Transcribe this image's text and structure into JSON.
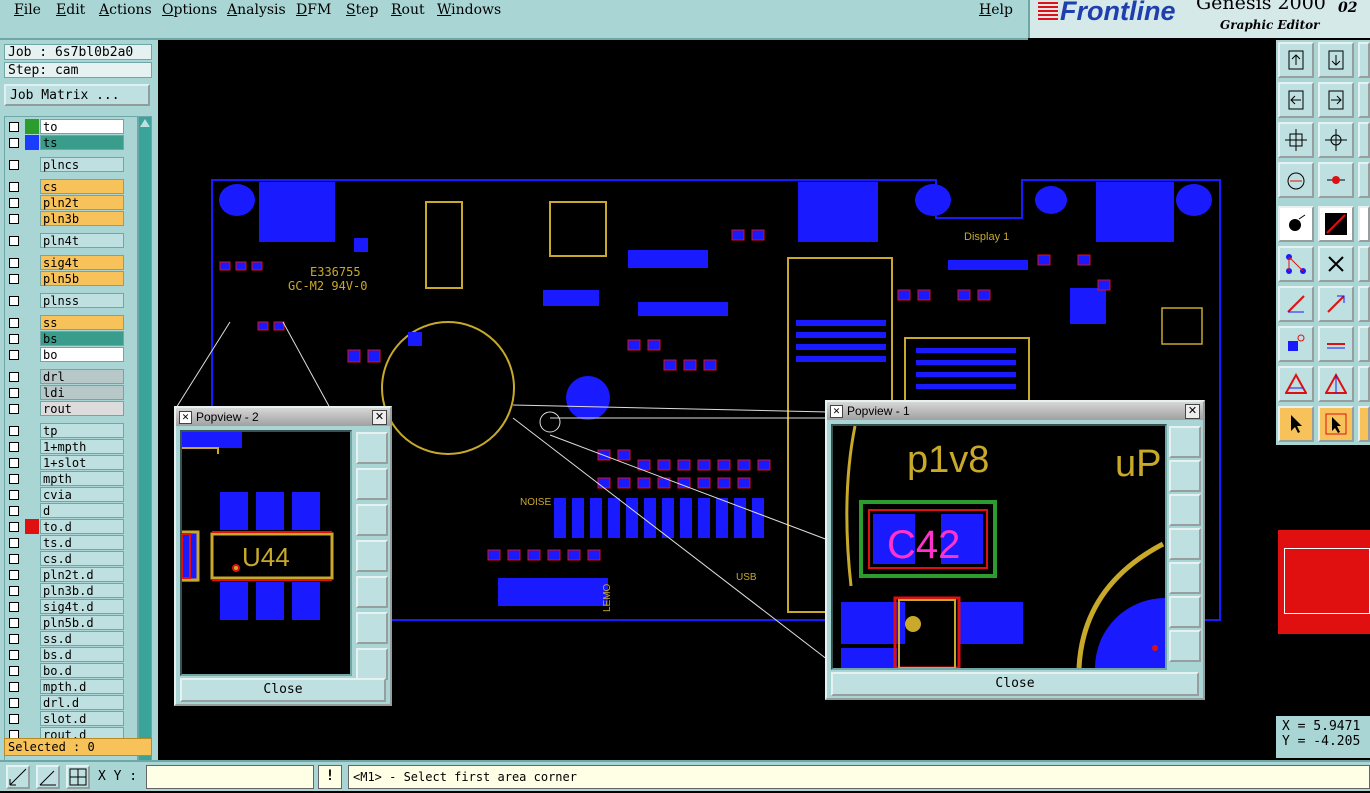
{
  "menubar": {
    "items": [
      "File",
      "Edit",
      "Actions",
      "Options",
      "Analysis",
      "DFM",
      "Step",
      "Rout",
      "Windows"
    ],
    "help": "Help"
  },
  "brand": {
    "logo": "Frontline",
    "product": "Genesis 2000",
    "version": "02",
    "subtitle": "Graphic Editor"
  },
  "left_panel": {
    "job": "Job : 6s7bl0b2a0",
    "step": "Step: cam",
    "job_matrix_button": "Job Matrix ...",
    "selected": "Selected : 0",
    "layers": [
      {
        "name": "to",
        "color": "#ffffff",
        "marker": "#2c9c2c"
      },
      {
        "name": "ts",
        "color": "#3a9c8a",
        "marker": "#1a3cff"
      },
      {
        "name": "plncs",
        "color": "#bfe0e0",
        "marker": ""
      },
      {
        "name": "cs",
        "color": "#f7c25a",
        "marker": ""
      },
      {
        "name": "pln2t",
        "color": "#f7c25a",
        "marker": ""
      },
      {
        "name": "pln3b",
        "color": "#f7c25a",
        "marker": ""
      },
      {
        "name": "pln4t",
        "color": "#bfe0e0",
        "marker": ""
      },
      {
        "name": "sig4t",
        "color": "#f7c25a",
        "marker": ""
      },
      {
        "name": "pln5b",
        "color": "#f7c25a",
        "marker": ""
      },
      {
        "name": "plnss",
        "color": "#bfe0e0",
        "marker": ""
      },
      {
        "name": "ss",
        "color": "#f7c25a",
        "marker": ""
      },
      {
        "name": "bs",
        "color": "#3a9c8a",
        "marker": ""
      },
      {
        "name": "bo",
        "color": "#ffffff",
        "marker": ""
      },
      {
        "name": "drl",
        "color": "#b8c8c8",
        "marker": ""
      },
      {
        "name": "ldi",
        "color": "#b8c8c8",
        "marker": ""
      },
      {
        "name": "rout",
        "color": "#dcdcdc",
        "marker": ""
      },
      {
        "name": "tp",
        "color": "#bfe0e0",
        "marker": ""
      },
      {
        "name": "1+mpth",
        "color": "#bfe0e0",
        "marker": ""
      },
      {
        "name": "1+slot",
        "color": "#bfe0e0",
        "marker": ""
      },
      {
        "name": "mpth",
        "color": "#bfe0e0",
        "marker": ""
      },
      {
        "name": "cvia",
        "color": "#bfe0e0",
        "marker": ""
      },
      {
        "name": "d",
        "color": "#bfe0e0",
        "marker": ""
      },
      {
        "name": "to.d",
        "color": "#bfe0e0",
        "marker": "#e01010"
      },
      {
        "name": "ts.d",
        "color": "#bfe0e0",
        "marker": ""
      },
      {
        "name": "cs.d",
        "color": "#bfe0e0",
        "marker": ""
      },
      {
        "name": "pln2t.d",
        "color": "#bfe0e0",
        "marker": ""
      },
      {
        "name": "pln3b.d",
        "color": "#bfe0e0",
        "marker": ""
      },
      {
        "name": "sig4t.d",
        "color": "#bfe0e0",
        "marker": ""
      },
      {
        "name": "pln5b.d",
        "color": "#bfe0e0",
        "marker": ""
      },
      {
        "name": "ss.d",
        "color": "#bfe0e0",
        "marker": ""
      },
      {
        "name": "bs.d",
        "color": "#bfe0e0",
        "marker": ""
      },
      {
        "name": "bo.d",
        "color": "#bfe0e0",
        "marker": ""
      },
      {
        "name": "mpth.d",
        "color": "#bfe0e0",
        "marker": ""
      },
      {
        "name": "drl.d",
        "color": "#bfe0e0",
        "marker": ""
      },
      {
        "name": "slot.d",
        "color": "#bfe0e0",
        "marker": ""
      },
      {
        "name": "rout.d",
        "color": "#bfe0e0",
        "marker": ""
      }
    ]
  },
  "bottom_bar": {
    "xy_label": "X Y :",
    "xy_value": "",
    "alert_icon": "!",
    "message": "<M1> - Select first area corner"
  },
  "coords": {
    "x": "X = 5.9471",
    "y": "Y = -4.205"
  },
  "board": {
    "silk_texts": [
      "E336755",
      "GC-M2 94V-0",
      "Display 1",
      "NOISE",
      "USB",
      "LEMO",
      "p1v8"
    ],
    "label_display": "Display 1",
    "label_noise": "NOISE",
    "label_usb": "USB",
    "label_lemo": "LEMO",
    "label_ul": "E336755",
    "label_gc": "GC-M2 94V-0"
  },
  "popview2": {
    "title": "Popview - 2",
    "component": "U44",
    "close_label": "Close"
  },
  "popview1": {
    "title": "Popview - 1",
    "net_label": "p1v8",
    "partial_label": "uP",
    "component": "C42",
    "close_label": "Close"
  },
  "colors": {
    "pad_blue": "#1a1aff",
    "silk_yellow": "#c8a92a",
    "outline_red": "#e01010",
    "outline_green": "#2c9c2c",
    "ui_teal": "#a9d5d5"
  }
}
